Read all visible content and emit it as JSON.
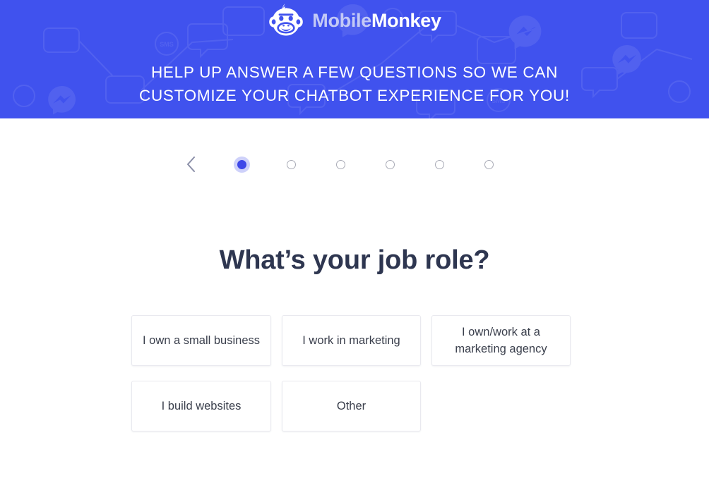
{
  "banner": {
    "background_color": "#4052ee",
    "logo": {
      "icon_name": "mobilemonkey-monkey-logo",
      "word_light": "Mobile",
      "word_bold": "Monkey",
      "word_light_color": "#c3c9f6",
      "word_bold_color": "#ffffff"
    },
    "headline_line1": "HELP UP ANSWER A FEW QUESTIONS SO WE CAN",
    "headline_line2": "CUSTOMIZE YOUR CHATBOT EXPERIENCE FOR YOU!",
    "headline_color": "#ffffff"
  },
  "stepper": {
    "back_icon": "chevron-left-icon",
    "back_icon_color": "#8b8fa8",
    "active_color": "#3f49e8",
    "inactive_border_color": "#a9abb6",
    "total_steps": 6,
    "active_step": 1,
    "steps": [
      {
        "index": 1,
        "state": "active"
      },
      {
        "index": 2,
        "state": "inactive"
      },
      {
        "index": 3,
        "state": "inactive"
      },
      {
        "index": 4,
        "state": "inactive"
      },
      {
        "index": 5,
        "state": "inactive"
      },
      {
        "index": 6,
        "state": "inactive"
      }
    ]
  },
  "question": {
    "title": "What’s your job role?",
    "title_color": "#2e3650"
  },
  "options": {
    "border_color": "#e9e9ef",
    "text_color": "#3a3f4c",
    "rows": [
      [
        {
          "label": "I own a small business"
        },
        {
          "label": "I work in marketing"
        },
        {
          "label": "I own/work at a marketing agency"
        }
      ],
      [
        {
          "label": "I build websites"
        },
        {
          "label": "Other"
        }
      ]
    ]
  }
}
